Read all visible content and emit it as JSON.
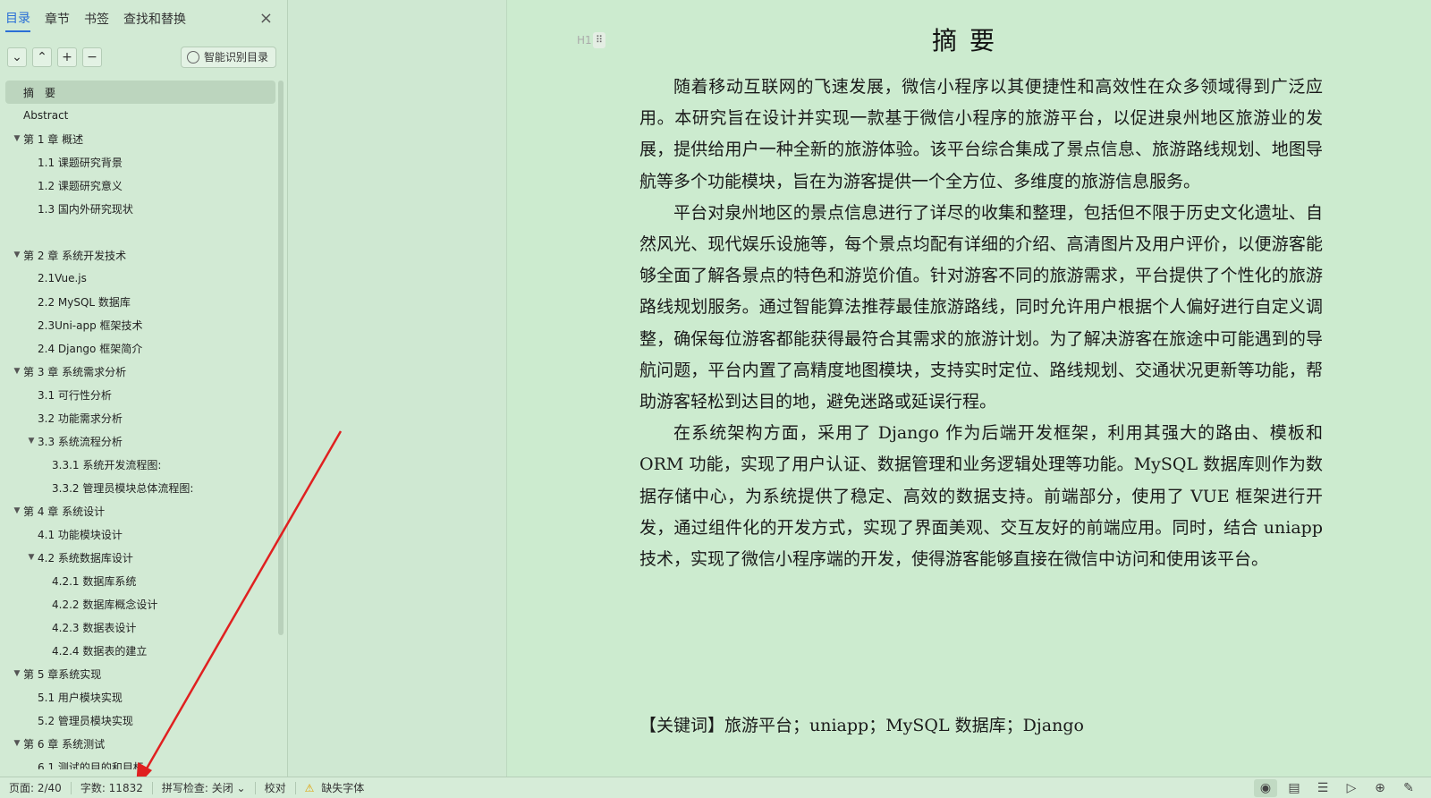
{
  "sidebar": {
    "tabs": [
      "目录",
      "章节",
      "书签",
      "查找和替换"
    ],
    "close_icon": "×",
    "tools": [
      "⌄",
      "⌃",
      "+",
      "−"
    ],
    "smart_button": "智能识别目录",
    "toc": [
      {
        "label": "摘　要",
        "level": 1,
        "arrow": "",
        "selected": true
      },
      {
        "label": "Abstract",
        "level": 1,
        "arrow": ""
      },
      {
        "label": "第 1 章  概述",
        "level": 1,
        "arrow": "▼"
      },
      {
        "label": "1.1 课题研究背景",
        "level": 2,
        "arrow": ""
      },
      {
        "label": "1.2 课题研究意义",
        "level": 2,
        "arrow": ""
      },
      {
        "label": "1.3 国内外研究现状",
        "level": 2,
        "arrow": ""
      },
      {
        "label": "",
        "level": 2,
        "arrow": ""
      },
      {
        "label": "第 2 章  系统开发技术",
        "level": 1,
        "arrow": "▼"
      },
      {
        "label": "2.1Vue.js",
        "level": 2,
        "arrow": ""
      },
      {
        "label": "2.2 MySQL 数据库",
        "level": 2,
        "arrow": ""
      },
      {
        "label": "2.3Uni-app 框架技术",
        "level": 2,
        "arrow": ""
      },
      {
        "label": "2.4 Django 框架简介",
        "level": 2,
        "arrow": ""
      },
      {
        "label": "第 3 章  系统需求分析",
        "level": 1,
        "arrow": "▼"
      },
      {
        "label": "3.1 可行性分析",
        "level": 2,
        "arrow": ""
      },
      {
        "label": "3.2 功能需求分析",
        "level": 2,
        "arrow": ""
      },
      {
        "label": "3.3 系统流程分析",
        "level": 2,
        "arrow": "▼"
      },
      {
        "label": "3.3.1 系统开发流程图:",
        "level": 3,
        "arrow": ""
      },
      {
        "label": "3.3.2 管理员模块总体流程图:",
        "level": 3,
        "arrow": ""
      },
      {
        "label": "第 4 章  系统设计",
        "level": 1,
        "arrow": "▼"
      },
      {
        "label": "4.1 功能模块设计",
        "level": 2,
        "arrow": ""
      },
      {
        "label": "4.2 系统数据库设计",
        "level": 2,
        "arrow": "▼"
      },
      {
        "label": "4.2.1 数据库系统",
        "level": 3,
        "arrow": ""
      },
      {
        "label": "4.2.2 数据库概念设计",
        "level": 3,
        "arrow": ""
      },
      {
        "label": "4.2.3 数据表设计",
        "level": 3,
        "arrow": ""
      },
      {
        "label": "4.2.4 数据表的建立",
        "level": 3,
        "arrow": ""
      },
      {
        "label": "第 5 章系统实现",
        "level": 1,
        "arrow": "▼"
      },
      {
        "label": "5.1  用户模块实现",
        "level": 2,
        "arrow": ""
      },
      {
        "label": "5.2  管理员模块实现",
        "level": 2,
        "arrow": ""
      },
      {
        "label": "第 6 章  系统测试",
        "level": 1,
        "arrow": "▼"
      },
      {
        "label": "6.1 测试的目的和目标",
        "level": 2,
        "arrow": ""
      }
    ]
  },
  "document": {
    "heading_marker": "H1",
    "drag_handle": "⠿",
    "title": "摘要",
    "paragraphs": [
      "随着移动互联网的飞速发展，微信小程序以其便捷性和高效性在众多领域得到广泛应用。本研究旨在设计并实现一款基于微信小程序的旅游平台，以促进泉州地区旅游业的发展，提供给用户一种全新的旅游体验。该平台综合集成了景点信息、旅游路线规划、地图导航等多个功能模块，旨在为游客提供一个全方位、多维度的旅游信息服务。",
      "平台对泉州地区的景点信息进行了详尽的收集和整理，包括但不限于历史文化遗址、自然风光、现代娱乐设施等，每个景点均配有详细的介绍、高清图片及用户评价，以便游客能够全面了解各景点的特色和游览价值。针对游客不同的旅游需求，平台提供了个性化的旅游路线规划服务。通过智能算法推荐最佳旅游路线，同时允许用户根据个人偏好进行自定义调整，确保每位游客都能获得最符合其需求的旅游计划。为了解决游客在旅途中可能遇到的导航问题，平台内置了高精度地图模块，支持实时定位、路线规划、交通状况更新等功能，帮助游客轻松到达目的地，避免迷路或延误行程。",
      "在系统架构方面，采用了 Django 作为后端开发框架，利用其强大的路由、模板和 ORM 功能，实现了用户认证、数据管理和业务逻辑处理等功能。MySQL 数据库则作为数据存储中心，为系统提供了稳定、高效的数据支持。前端部分，使用了 VUE 框架进行开发，通过组件化的开发方式，实现了界面美观、交互友好的前端应用。同时，结合 uniapp 技术，实现了微信小程序端的开发，使得游客能够直接在微信中访问和使用该平台。"
    ],
    "keywords": "【关键词】旅游平台；uniapp；MySQL 数据库；Django"
  },
  "statusbar": {
    "page": "页面: 2/40",
    "words": "字数: 11832",
    "spell": "拼写检查: 关闭",
    "spell_caret": "⌄",
    "proof": "校对",
    "warning_icon": "⚠",
    "missing_font": "缺失字体",
    "icons": [
      "◉",
      "▤",
      "☰",
      "▷",
      "⊕",
      "✎"
    ]
  },
  "colors": {
    "accent": "#2a6fd6",
    "arrow": "#e02020",
    "background": "#cfe8d2"
  }
}
